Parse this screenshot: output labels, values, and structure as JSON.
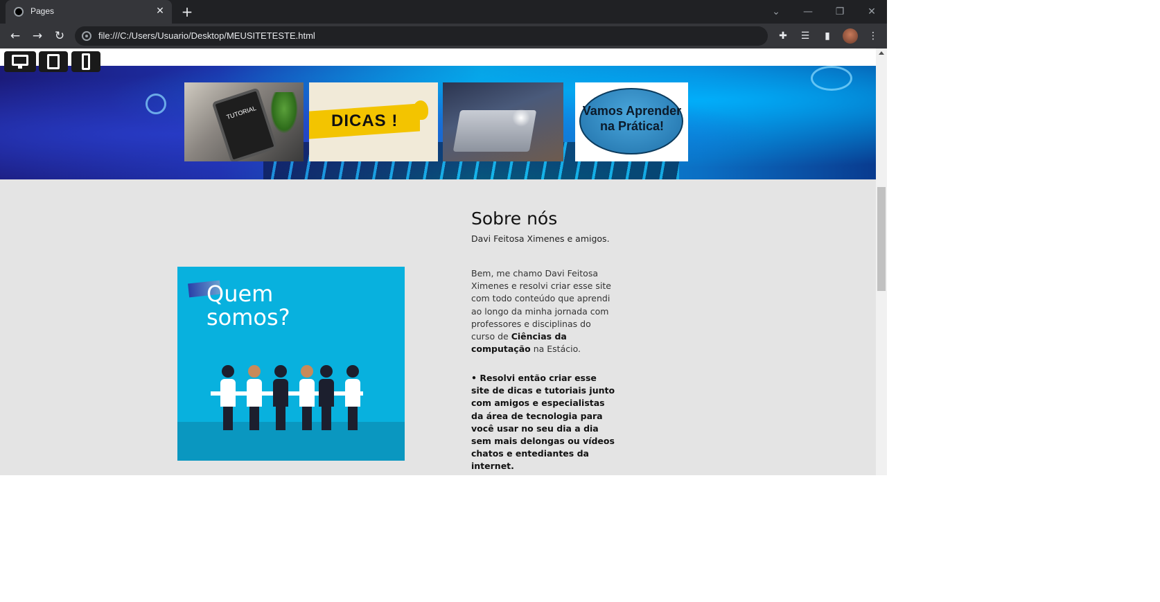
{
  "browser": {
    "tab_title": "Pages",
    "tab_close": "✕",
    "new_tab": "+",
    "url": "file:///C:/Users/Usuario/Desktop/MEUSITETESTE.html",
    "window_controls": {
      "dropdown": "⌄",
      "minimize": "—",
      "restore": "❐",
      "close": "✕"
    },
    "nav": {
      "back": "←",
      "forward": "→",
      "reload": "↻"
    },
    "icons": [
      "puzzle-icon",
      "media-queue-icon",
      "side-panel-icon",
      "profile-avatar",
      "kebab-menu-icon"
    ],
    "icon_glyphs": {
      "extensions": "✚",
      "media": "☰",
      "sidepanel": "▮",
      "menu": "⋮"
    }
  },
  "device_toggles": [
    "desktop-icon",
    "tablet-icon",
    "phone-icon"
  ],
  "hero": {
    "thumbnails": [
      {
        "name": "tutorial",
        "text": "TUTORIAL"
      },
      {
        "name": "dicas",
        "text": "DICAS !"
      },
      {
        "name": "laptop",
        "text": ""
      },
      {
        "name": "vamos-aprender",
        "text": "Vamos Aprender na Prática!"
      }
    ]
  },
  "about": {
    "image_text": "Quem somos?",
    "title": "Sobre nós",
    "subtitle": "Davi Feitosa Ximenes e amigos.",
    "paragraph1_plain": "Bem, me chamo Davi Feitosa Ximenes e resolvi criar esse site com todo conteúdo que aprendi ao longo da minha jornada com professores e disciplinas do curso de",
    "paragraph1_bold": "Ciências da computação",
    "paragraph1_tail": "na Estácio.",
    "paragraph2": "• Resolvi então criar esse site de dicas e tutoriais junto com amigos e especialistas da área de tecnologia para você usar no seu dia a dia sem mais delongas ou vídeos chatos e entediantes da internet."
  }
}
